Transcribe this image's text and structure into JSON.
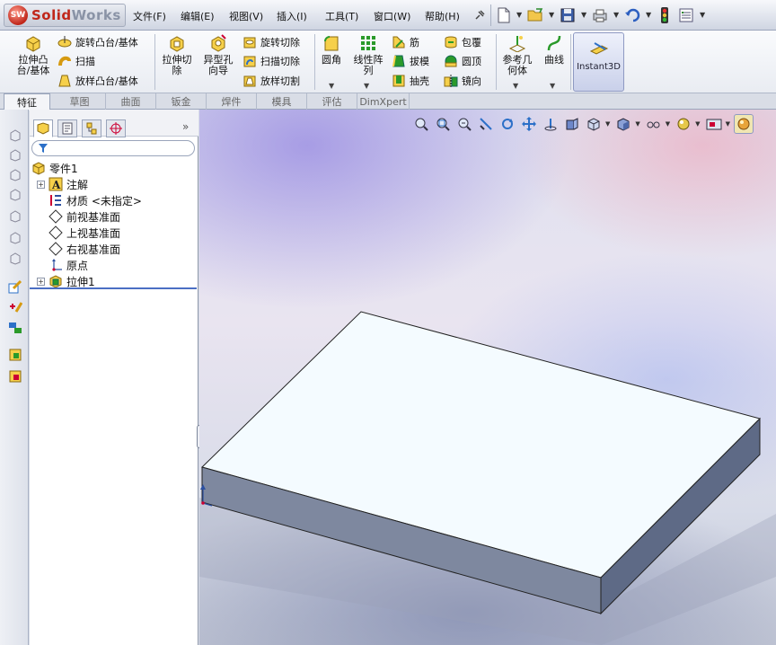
{
  "app": {
    "logo_mark": "SW",
    "logo_text_a": "Solid",
    "logo_text_b": "Works"
  },
  "menu": [
    "文件(F)",
    "编辑(E)",
    "视图(V)",
    "插入(I)",
    "工具(T)",
    "窗口(W)",
    "帮助(H)"
  ],
  "quick_access": [
    "new-doc",
    "open-folder",
    "save",
    "print",
    "undo",
    "rebuild-light",
    "options"
  ],
  "commands": {
    "extrude_boss": "拉伸凸\n台/基体",
    "revolve_boss": "旋转凸台/基体",
    "sweep": "扫描",
    "loft_boss": "放样凸台/基体",
    "extrude_cut": "拉伸切\n除",
    "hole_wizard": "异型孔\n向导",
    "revolve_cut": "旋转切除",
    "sweep_cut": "扫描切除",
    "loft_cut": "放样切割",
    "fillet": "圆角",
    "linear_pattern": "线性阵\n列",
    "rib": "筋",
    "draft": "拔模",
    "shell": "抽壳",
    "wrap": "包覆",
    "dome": "圆顶",
    "mirror": "镜向",
    "ref_geometry": "参考几\n何体",
    "curves": "曲线",
    "instant3d": "Instant3D"
  },
  "tabs": [
    {
      "label": "特征",
      "active": true
    },
    {
      "label": "草图",
      "active": false
    },
    {
      "label": "曲面",
      "active": false
    },
    {
      "label": "钣金",
      "active": false
    },
    {
      "label": "焊件",
      "active": false
    },
    {
      "label": "模具",
      "active": false
    },
    {
      "label": "评估",
      "active": false
    },
    {
      "label": "DimXpert",
      "active": false
    }
  ],
  "feature_tree": {
    "root": "零件1",
    "items": [
      {
        "label": "注解",
        "expandable": true,
        "icon": "annotation-icon"
      },
      {
        "label": "材质 <未指定>",
        "expandable": false,
        "icon": "material-icon"
      },
      {
        "label": "前视基准面",
        "expandable": false,
        "icon": "plane-icon"
      },
      {
        "label": "上视基准面",
        "expandable": false,
        "icon": "plane-icon"
      },
      {
        "label": "右视基准面",
        "expandable": false,
        "icon": "plane-icon"
      },
      {
        "label": "原点",
        "expandable": false,
        "icon": "origin-icon"
      },
      {
        "label": "拉伸1",
        "expandable": true,
        "icon": "extrude-feature-icon"
      }
    ]
  },
  "fm_more": "»",
  "colors": {
    "accent": "#4b6fc4",
    "model_top": "#f4fbff",
    "model_front": "#7e889f",
    "model_side": "#5e6a86"
  }
}
